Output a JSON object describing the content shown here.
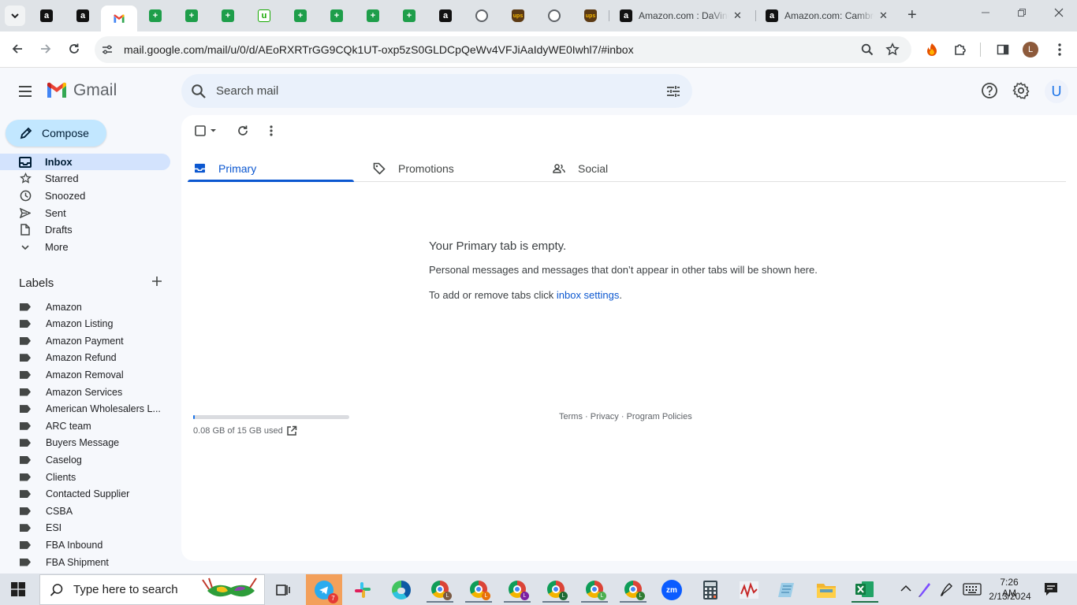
{
  "browser": {
    "pinned_tabs": [
      {
        "icon": "amazon-icon",
        "glyph": "a"
      },
      {
        "icon": "amazon-icon",
        "glyph": "a"
      },
      {
        "icon": "gmail-icon",
        "glyph": "M"
      },
      {
        "icon": "sheets-icon",
        "glyph": "+"
      },
      {
        "icon": "sheets-icon",
        "glyph": "+"
      },
      {
        "icon": "sheets-icon",
        "glyph": "+"
      },
      {
        "icon": "upwork-icon",
        "glyph": "u"
      },
      {
        "icon": "sheets-icon",
        "glyph": "+"
      },
      {
        "icon": "sheets-icon",
        "glyph": "+"
      },
      {
        "icon": "sheets-icon",
        "glyph": "+"
      },
      {
        "icon": "sheets-icon",
        "glyph": "+"
      },
      {
        "icon": "amazon-icon",
        "glyph": "a"
      },
      {
        "icon": "globe-icon",
        "glyph": ""
      },
      {
        "icon": "ups-icon",
        "glyph": "ups"
      },
      {
        "icon": "globe-icon",
        "glyph": ""
      },
      {
        "icon": "ups-icon",
        "glyph": "ups"
      }
    ],
    "tabs": [
      {
        "title": "Amazon.com : DaVinci"
      },
      {
        "title": "Amazon.com: Cambro"
      }
    ],
    "url": "mail.google.com/mail/u/0/d/AEoRXRTrGG9CQk1UT-oxp5zS0GLDCpQeWv4VFJiAaIdyWE0Iwhl7/#inbox",
    "profile_initial": "L"
  },
  "gmail": {
    "app_name": "Gmail",
    "search_placeholder": "Search mail",
    "account_initial": "U",
    "compose_label": "Compose",
    "nav": [
      {
        "label": "Inbox",
        "icon": "inbox-icon",
        "active": true
      },
      {
        "label": "Starred",
        "icon": "star-icon",
        "active": false
      },
      {
        "label": "Snoozed",
        "icon": "clock-icon",
        "active": false
      },
      {
        "label": "Sent",
        "icon": "send-icon",
        "active": false
      },
      {
        "label": "Drafts",
        "icon": "draft-icon",
        "active": false
      },
      {
        "label": "More",
        "icon": "chevron-down-icon",
        "active": false
      }
    ],
    "labels_title": "Labels",
    "labels": [
      "Amazon",
      "Amazon Listing",
      "Amazon Payment",
      "Amazon Refund",
      "Amazon Removal",
      "Amazon Services",
      "American Wholesalers L...",
      "ARC team",
      "Buyers Message",
      "Caselog",
      "Clients",
      "Contacted Supplier",
      "CSBA",
      "ESI",
      "FBA Inbound",
      "FBA Shipment"
    ],
    "inbox_tabs": [
      {
        "label": "Primary",
        "icon": "inbox-icon",
        "active": true
      },
      {
        "label": "Promotions",
        "icon": "tag-icon",
        "active": false
      },
      {
        "label": "Social",
        "icon": "people-icon",
        "active": false
      }
    ],
    "empty": {
      "title": "Your Primary tab is empty.",
      "description": "Personal messages and messages that don’t appear in other tabs will be shown here.",
      "hint_prefix": "To add or remove tabs click ",
      "hint_link": "inbox settings",
      "hint_suffix": "."
    },
    "storage": {
      "text": "0.08 GB of 15 GB used",
      "used_fraction": 0.005
    },
    "footer": {
      "terms": "Terms",
      "privacy": "Privacy",
      "policies": "Program Policies",
      "sep": " · "
    }
  },
  "taskbar": {
    "search_placeholder": "Type here to search",
    "telegram_badge": "7",
    "chrome_profiles": [
      {
        "badge": "L",
        "color": "#7a5a44"
      },
      {
        "badge": "L",
        "color": "#e8710a"
      },
      {
        "badge": "L",
        "color": "#7b1fa2"
      },
      {
        "badge": "L",
        "color": "#1e6b35"
      },
      {
        "badge": "L",
        "color": "#4caf50"
      },
      {
        "badge": "L",
        "color": "#2e7d32"
      }
    ],
    "time": "7:26 AM",
    "date": "2/13/2024"
  },
  "colors": {
    "gmail_accent": "#0b57d0",
    "compose_bg": "#c2e7ff",
    "active_nav_bg": "#d3e3fd"
  }
}
